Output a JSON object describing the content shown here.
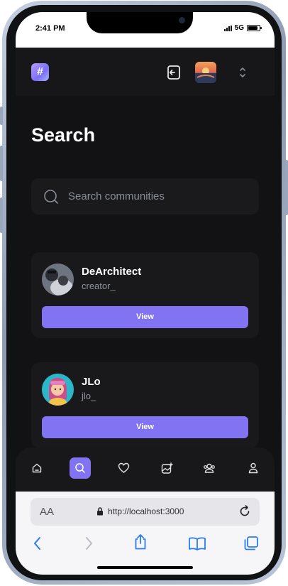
{
  "status_bar": {
    "time": "2:41 PM",
    "network": "5G",
    "battery_level": 0.85
  },
  "header": {
    "logo_glyph": "#",
    "icons": [
      "logo-icon",
      "logout-icon",
      "user-avatar",
      "chevron-up-down-icon"
    ]
  },
  "page": {
    "title": "Search"
  },
  "search": {
    "placeholder": "Search communities",
    "value": ""
  },
  "results": [
    {
      "name": "DeArchitect",
      "handle": "creator_",
      "button": "View"
    },
    {
      "name": "JLo",
      "handle": "jlo_",
      "button": "View"
    }
  ],
  "bottom_nav": {
    "items": [
      "home-icon",
      "search-icon",
      "heart-icon",
      "create-post-icon",
      "communities-icon",
      "profile-icon"
    ],
    "active": "search-icon"
  },
  "browser": {
    "text_size_label": "AA",
    "url": "http://localhost:3000"
  },
  "colors": {
    "accent": "#8173f2",
    "background": "#121214",
    "card": "#19191c"
  }
}
